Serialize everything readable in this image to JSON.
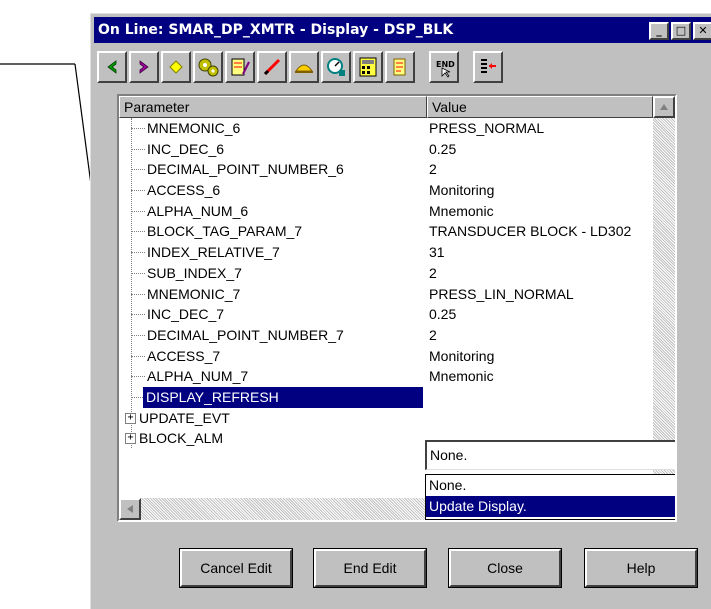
{
  "window": {
    "title": "On Line: SMAR_DP_XMTR - Display - DSP_BLK",
    "minimize_glyph": "_",
    "maximize_glyph": "□",
    "close_glyph": "✕"
  },
  "toolbar": {
    "buttons": [
      {
        "icon": "arrow-left-icon",
        "color": "#008000"
      },
      {
        "icon": "arrow-right-icon",
        "color": "#800080"
      },
      {
        "icon": "diamond-icon",
        "color": "#ffff00"
      },
      {
        "icon": "gears-icon",
        "color": "#808000"
      },
      {
        "icon": "instrument-icon",
        "color": "#ff0000"
      },
      {
        "icon": "pencil-icon",
        "color": "#ff0000"
      },
      {
        "icon": "hat-icon",
        "color": "#ffff00"
      },
      {
        "icon": "gauge-icon",
        "color": "#008080"
      },
      {
        "icon": "calculator-icon",
        "color": "#ffff00"
      },
      {
        "icon": "scroll-icon",
        "color": "#ffff00"
      },
      {
        "icon": "end-icon",
        "color": "#000000"
      },
      {
        "icon": "list-arrow-icon",
        "color": "#ff0000"
      }
    ],
    "end_text": "END"
  },
  "table": {
    "col_parameter": "Parameter",
    "col_value": "Value",
    "rows": [
      {
        "name": "MNEMONIC_6",
        "value": "PRESS_NORMAL"
      },
      {
        "name": "INC_DEC_6",
        "value": "0.25"
      },
      {
        "name": "DECIMAL_POINT_NUMBER_6",
        "value": "2"
      },
      {
        "name": "ACCESS_6",
        "value": "Monitoring"
      },
      {
        "name": "ALPHA_NUM_6",
        "value": "Mnemonic"
      },
      {
        "name": "BLOCK_TAG_PARAM_7",
        "value": "TRANSDUCER BLOCK - LD302"
      },
      {
        "name": "INDEX_RELATIVE_7",
        "value": "31"
      },
      {
        "name": "SUB_INDEX_7",
        "value": "2"
      },
      {
        "name": "MNEMONIC_7",
        "value": "PRESS_LIN_NORMAL"
      },
      {
        "name": "INC_DEC_7",
        "value": "0.25"
      },
      {
        "name": "DECIMAL_POINT_NUMBER_7",
        "value": "2"
      },
      {
        "name": "ACCESS_7",
        "value": "Monitoring"
      },
      {
        "name": "ALPHA_NUM_7",
        "value": "Mnemonic"
      }
    ],
    "selected_row": {
      "name": "DISPLAY_REFRESH",
      "value": "None."
    },
    "groups": [
      {
        "name": "UPDATE_EVT"
      },
      {
        "name": "BLOCK_ALM"
      }
    ]
  },
  "dropdown": {
    "options": [
      "None.",
      "Update Display."
    ],
    "highlighted": "Update Display."
  },
  "buttons": {
    "cancel_edit": "Cancel Edit",
    "end_edit": "End Edit",
    "close": "Close",
    "help": "Help"
  },
  "colors": {
    "title_bar": "#000080",
    "selection": "#000080",
    "face": "#c0c0c0"
  }
}
